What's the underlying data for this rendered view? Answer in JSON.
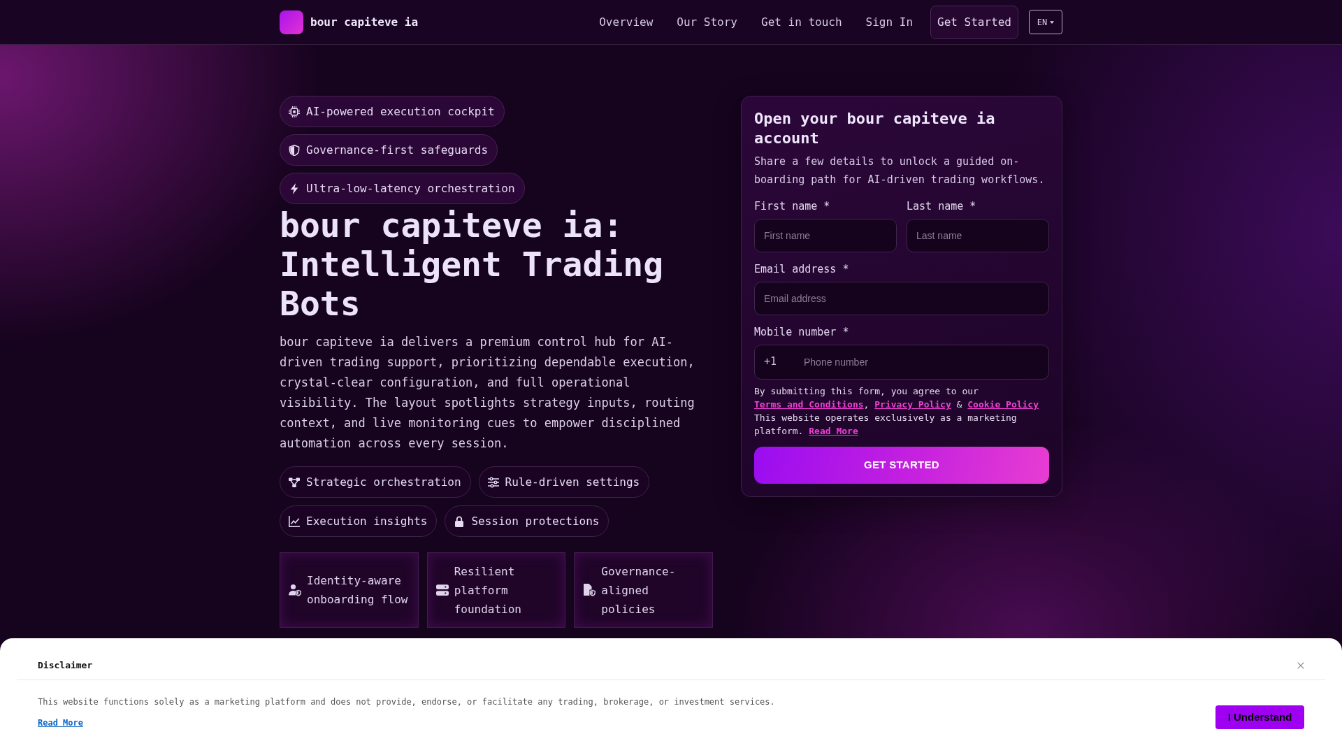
{
  "header": {
    "brand": "bour capiteve ia",
    "nav": [
      {
        "label": "Overview",
        "kind": "link"
      },
      {
        "label": "Our Story",
        "kind": "link"
      },
      {
        "label": "Get in touch",
        "kind": "link"
      },
      {
        "label": "Sign In",
        "kind": "link"
      },
      {
        "label": "Get Started",
        "kind": "button"
      }
    ],
    "language": "EN"
  },
  "hero": {
    "badges": [
      "AI-powered execution cockpit",
      "Governance-first safeguards",
      "Ultra-low-latency orchestration"
    ],
    "title": "bour capiteve ia: Intelligent Trading Bots",
    "description": "bour capiteve ia delivers a premium control hub for AI-driven trading support, prioritizing dependable execution, crystal-clear configuration, and full operational visibility. The layout spotlights strategy inputs, routing context, and live monitoring cues to empower disciplined automation across every session.",
    "features": [
      "Strategic orchestration",
      "Rule-driven settings",
      "Execution insights",
      "Session protections"
    ],
    "highlights": [
      "Identity-aware onboarding flow",
      "Resilient platform foundation",
      "Governance-aligned policies"
    ]
  },
  "signup": {
    "title": "Open your bour capiteve ia account",
    "subtitle": "Share a few details to unlock a guided on-boarding path for AI-driven trading workflows.",
    "fields": [
      {
        "label": "First name *",
        "placeholder": "First name"
      },
      {
        "label": "Last name *",
        "placeholder": "Last name"
      },
      {
        "label": "Email address *",
        "placeholder": "Email address"
      },
      {
        "label": "Mobile number *",
        "prefix": "+1",
        "placeholder": "Phone number"
      }
    ],
    "consent": [
      {
        "kind": "text",
        "text": "By submitting this form, you agree to our "
      },
      {
        "kind": "link",
        "text": "Terms and Conditions"
      },
      {
        "kind": "text",
        "text": ", "
      },
      {
        "kind": "link",
        "text": "Privacy Policy"
      },
      {
        "kind": "text",
        "text": " & "
      },
      {
        "kind": "link",
        "text": "Cookie Policy"
      },
      {
        "kind": "text",
        "text": " This website operates exclusively as a marketing platform. "
      },
      {
        "kind": "link",
        "text": "Read More"
      }
    ],
    "submit": "GET STARTED"
  },
  "disclaimer": {
    "title": "Disclaimer",
    "text": "This website functions solely as a marketing platform and does not provide, endorse, or facilitate any trading, brokerage, or investment services.",
    "link": "Read More",
    "button": "I Understand"
  }
}
